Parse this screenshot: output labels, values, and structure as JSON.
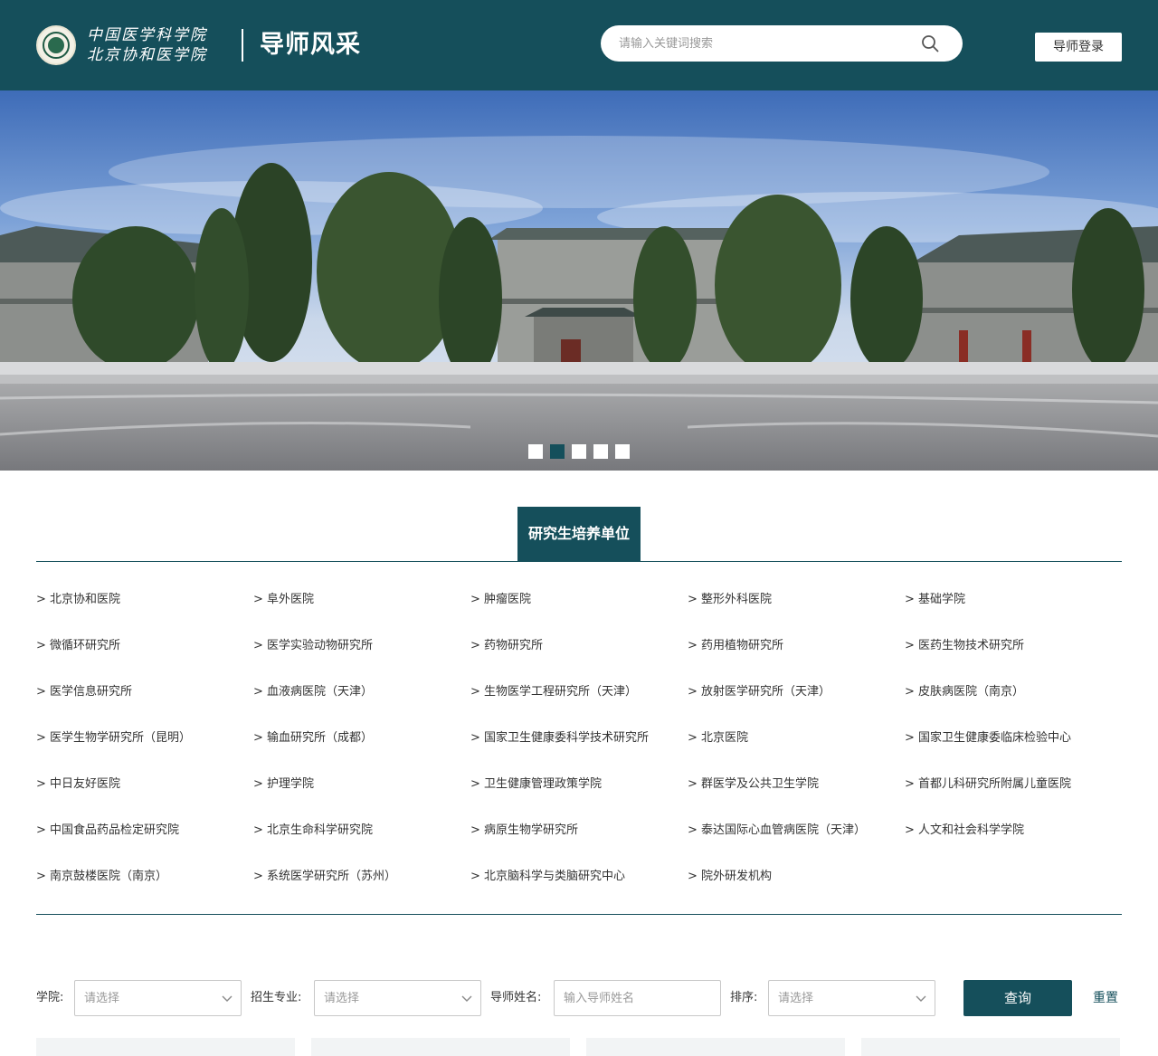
{
  "header": {
    "logo_line1": "中国医学科学院",
    "logo_line2": "北京协和医学院",
    "site_title": "导师风采",
    "search_placeholder": "请输入关键词搜索",
    "login_label": "导师登录"
  },
  "banner": {
    "slide_count": 5,
    "active_index": 1
  },
  "section": {
    "title": "研究生培养单位",
    "units": [
      [
        "> 北京协和医院",
        "> 阜外医院",
        "> 肿瘤医院",
        "> 整形外科医院",
        "> 基础学院"
      ],
      [
        "> 微循环研究所",
        "> 医学实验动物研究所",
        "> 药物研究所",
        "> 药用植物研究所",
        "> 医药生物技术研究所"
      ],
      [
        "> 医学信息研究所",
        "> 血液病医院（天津）",
        "> 生物医学工程研究所（天津）",
        "> 放射医学研究所（天津）",
        "> 皮肤病医院（南京）"
      ],
      [
        "> 医学生物学研究所（昆明）",
        "> 输血研究所（成都）",
        "> 国家卫生健康委科学技术研究所",
        "> 北京医院",
        "> 国家卫生健康委临床检验中心"
      ],
      [
        "> 中日友好医院",
        "> 护理学院",
        "> 卫生健康管理政策学院",
        "> 群医学及公共卫生学院",
        "> 首都儿科研究所附属儿童医院"
      ],
      [
        "> 中国食品药品检定研究院",
        "> 北京生命科学研究院",
        "> 病原生物学研究所",
        "> 泰达国际心血管病医院（天津）",
        "> 人文和社会科学学院"
      ],
      [
        "> 南京鼓楼医院（南京）",
        "> 系统医学研究所（苏州）",
        "> 北京脑科学与类脑研究中心",
        "> 院外研发机构"
      ]
    ]
  },
  "filters": {
    "college_label": "学院:",
    "college_placeholder": "请选择",
    "major_label": "招生专业:",
    "major_placeholder": "请选择",
    "name_label": "导师姓名:",
    "name_placeholder": "输入导师姓名",
    "sort_label": "排序:",
    "sort_placeholder": "请选择",
    "query_label": "查询",
    "reset_label": "重置"
  },
  "colors": {
    "brand": "#154f5b",
    "white": "#ffffff"
  }
}
